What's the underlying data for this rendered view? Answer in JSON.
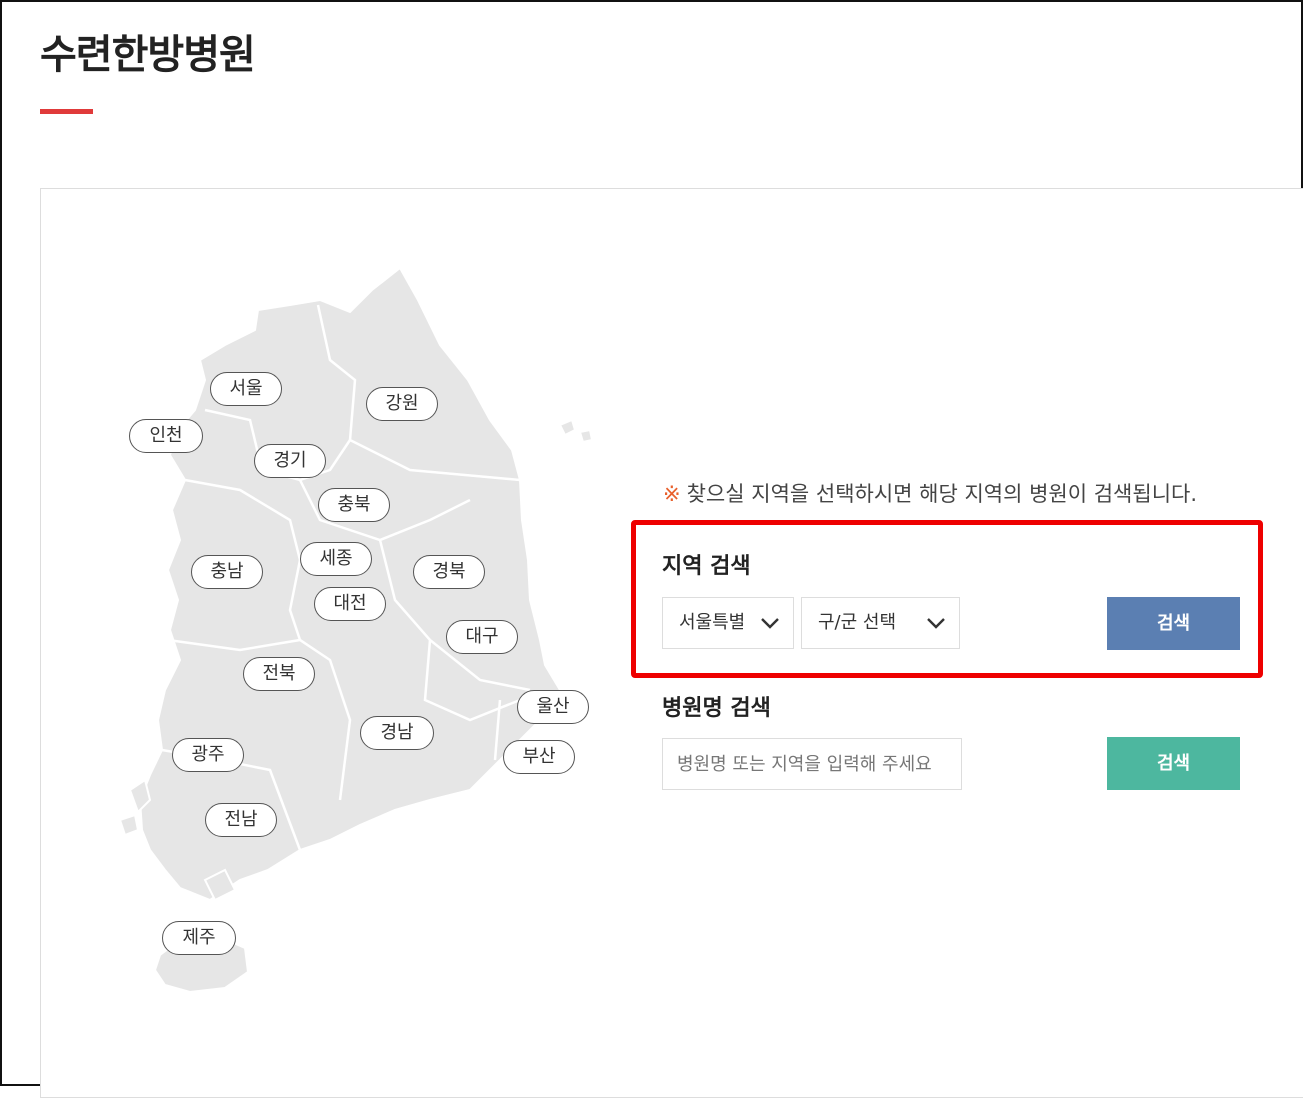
{
  "page": {
    "title": "수련한방병원"
  },
  "map": {
    "regions": [
      "서울",
      "강원",
      "인천",
      "경기",
      "충북",
      "충남",
      "세종",
      "경북",
      "대전",
      "대구",
      "전북",
      "울산",
      "경남",
      "부산",
      "광주",
      "전남",
      "제주"
    ]
  },
  "search": {
    "notice_mark": "※",
    "notice": "찾으실 지역을 선택하시면 해당 지역의 병원이 검색됩니다.",
    "region_search": {
      "title": "지역 검색",
      "city_value": "서울특별시",
      "district_value": "구/군 선택",
      "button_label": "검색",
      "button_color": "#5b7fb2"
    },
    "name_search": {
      "title": "병원명 검색",
      "placeholder": "병원명 또는 지역을 입력해 주세요",
      "button_label": "검색",
      "button_color": "#4db79f"
    },
    "highlight_color": "#ee0000"
  }
}
